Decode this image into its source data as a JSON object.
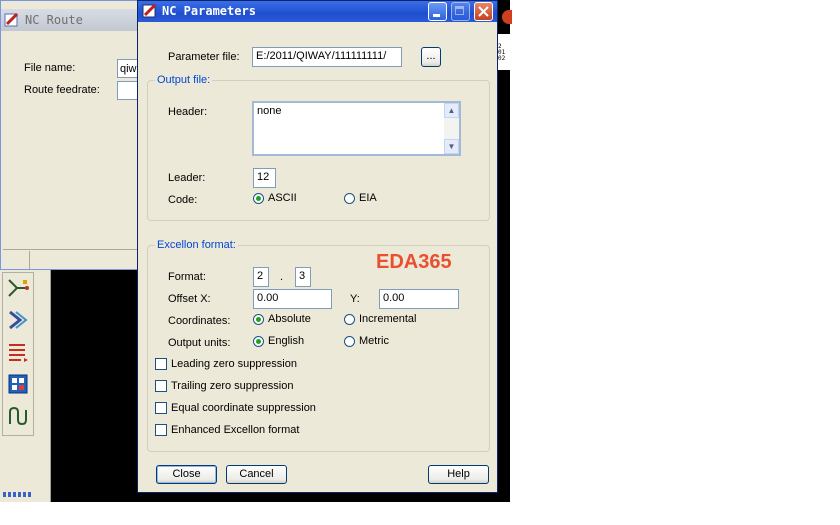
{
  "route_window": {
    "title": "NC Route",
    "file_name_label": "File name:",
    "file_name_value": "qiw",
    "feedrate_label": "Route feedrate:",
    "feedrate_value": ""
  },
  "right_strip_text": [
    "2",
    "01",
    "02"
  ],
  "dialog": {
    "title": "NC Parameters",
    "parameter_file_label": "Parameter file:",
    "parameter_file_value": "E:/2011/QIWAY/111111111/",
    "browse_label": "...",
    "output_group": {
      "label": "Output file:",
      "header_label": "Header:",
      "header_value": "none",
      "leader_label": "Leader:",
      "leader_value": "12",
      "code_label": "Code:",
      "code_options": [
        "ASCII",
        "EIA"
      ],
      "code_selected": "ASCII"
    },
    "excellon_group": {
      "label": "Excellon format:",
      "watermark": "EDA365",
      "format_label": "Format:",
      "format_int": "2",
      "format_sep": ".",
      "format_dec": "3",
      "offset_x_label": "Offset X:",
      "offset_x_value": "0.00",
      "offset_y_label": "Y:",
      "offset_y_value": "0.00",
      "coordinates_label": "Coordinates:",
      "coordinates_options": [
        "Absolute",
        "Incremental"
      ],
      "coordinates_selected": "Absolute",
      "units_label": "Output units:",
      "units_options": [
        "English",
        "Metric"
      ],
      "units_selected": "English",
      "checkboxes": [
        "Leading zero suppression",
        "Trailing zero suppression",
        "Equal coordinate suppression",
        "Enhanced Excellon format"
      ]
    },
    "buttons": {
      "close": "Close",
      "cancel": "Cancel",
      "help": "Help"
    }
  },
  "colors": {
    "title_bar": "#1f4fcf",
    "group_label": "#0046d5",
    "watermark": "#e8502f",
    "radio_dot": "#21a121"
  }
}
